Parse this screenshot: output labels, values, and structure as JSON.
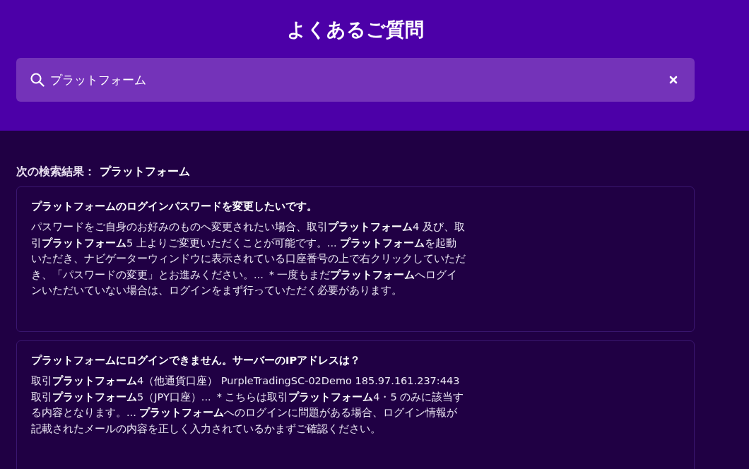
{
  "page_title": "よくあるご質問",
  "search": {
    "value": "プラットフォーム"
  },
  "results": {
    "label": "次の検索結果：",
    "query": "プラットフォーム",
    "items": [
      {
        "title": "プラットフォームのログインパスワードを変更したいです。",
        "snippet": "パスワードをご自身のお好みのものへ変更されたい場合、取引**プラットフォーム**4 及び、取引**プラットフォーム**5 上よりご変更いただくことが可能です。... **プラットフォーム**を起動いただき、ナビゲーターウィンドウに表示されている口座番号の上で右クリックしていただき、「パスワードの変更」とお進みください。... ＊一度もまだ**プラットフォーム**へログインいただいていない場合は、ログインをまず行っていただく必要があります。"
      },
      {
        "title": "プラットフォームにログインできません。サーバーのIPアドレスは？",
        "snippet": "取引**プラットフォーム**4（他通貨口座） PurpleTradingSC-02Demo 185.97.161.237:443 取引**プラットフォーム**5（JPY口座）... ＊こちらは取引**プラットフォーム**4・5 のみに該当する内容となります。... **プラットフォーム**へのログインに問題がある場合、ログイン情報が記載されたメールの内容を正しく入力されているかまずご確認ください。"
      }
    ]
  }
}
